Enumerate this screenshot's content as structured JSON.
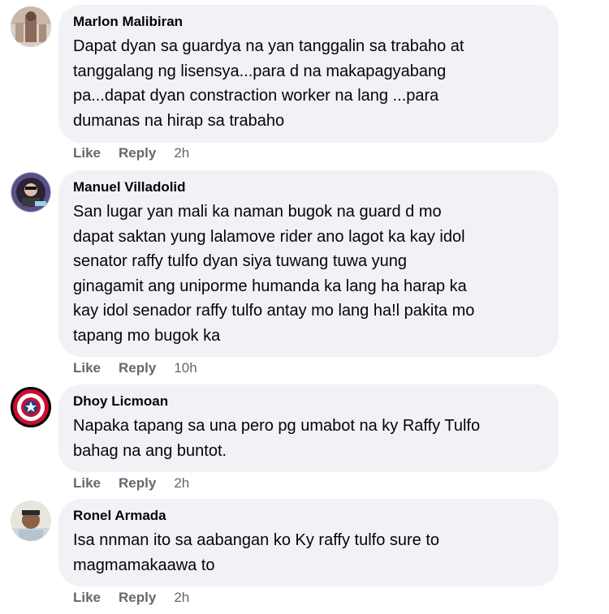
{
  "comments": [
    {
      "author": "Marlon Malibiran",
      "text": "Dapat dyan sa guardya na yan tanggalin sa trabaho at\ntanggalang ng lisensya...para d na makapagyabang\npa...dapat dyan constraction worker na lang ...para\ndumanas na hirap sa trabaho",
      "like": "Like",
      "reply": "Reply",
      "time": "2h"
    },
    {
      "author": "Manuel Villadolid",
      "text": "San lugar yan mali ka naman bugok na guard d mo\ndapat saktan yung lalamove rider ano lagot ka kay idol\nsenator raffy tulfo dyan siya tuwang tuwa yung\nginagamit ang uniporme humanda ka lang ha harap ka\nkay idol senador raffy tulfo antay mo lang ha!l pakita mo\ntapang mo bugok ka",
      "like": "Like",
      "reply": "Reply",
      "time": "10h"
    },
    {
      "author": "Dhoy Licmoan",
      "text": "Napaka tapang sa una pero pg umabot na ky Raffy Tulfo\nbahag na ang buntot.",
      "like": "Like",
      "reply": "Reply",
      "time": "2h"
    },
    {
      "author": "Ronel Armada",
      "text": "Isa nnman ito sa aabangan ko Ky raffy tulfo sure to\nmagmamakaawa to",
      "like": "Like",
      "reply": "Reply",
      "time": "2h"
    }
  ]
}
